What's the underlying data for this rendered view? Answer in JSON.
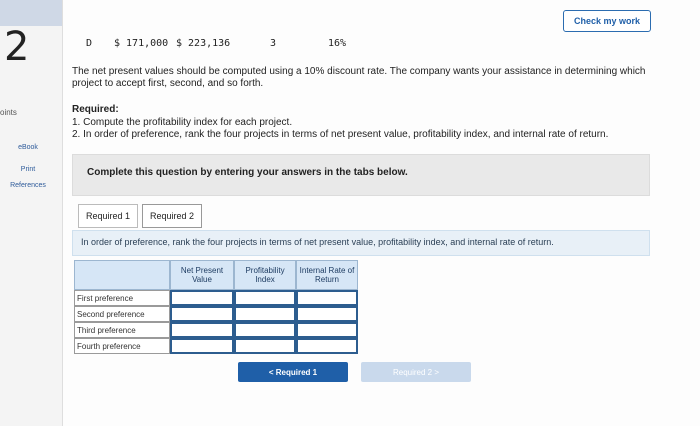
{
  "question": {
    "number": "2",
    "points_label": "oints"
  },
  "rail": {
    "ebook": "eBook",
    "print": "Print",
    "references": "References"
  },
  "header": {
    "check_button": "Check my work"
  },
  "table_fragment": {
    "project": "D",
    "investment": "$ 171,000",
    "pv": "$ 223,136",
    "life": "3",
    "irr": "16%"
  },
  "intro": "The net present values should be computed using a 10% discount rate. The company wants your assistance in determining which project to accept first, second, and so forth.",
  "required": {
    "heading": "Required:",
    "item1": "1. Compute the profitability index for each project.",
    "item2": "2. In order of preference, rank the four projects in terms of net present value, profitability index, and internal rate of return."
  },
  "instruction_box": "Complete this question by entering your answers in the tabs below.",
  "tabs": [
    "Required 1",
    "Required 2"
  ],
  "prompt": "In order of preference, rank the four projects in terms of net present value, profitability index, and internal rate of return.",
  "grid": {
    "columns": [
      "Net Present Value",
      "Profitability Index",
      "Internal Rate of Return"
    ],
    "rows": [
      "First preference",
      "Second preference",
      "Third preference",
      "Fourth preference"
    ]
  },
  "nav": {
    "prev": "< Required 1",
    "next": "Required 2 >"
  }
}
